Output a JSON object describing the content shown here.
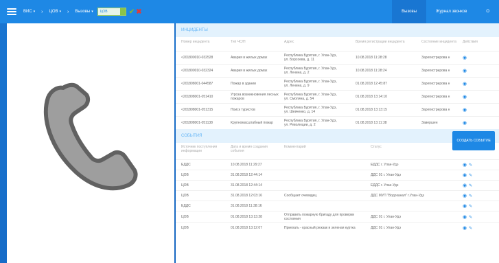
{
  "topbar": {
    "crumbs": [
      "ВИС",
      "ЦОВ",
      "Вызовы"
    ],
    "select_value": "ЦОВ",
    "ok_glyph": "✔",
    "cancel_glyph": "✖",
    "tabs": [
      "Вызовы",
      "Журнал звонков",
      "О"
    ]
  },
  "incidents": {
    "title": "ИНЦИДЕНТЫ",
    "columns": [
      "Номер инцидента",
      "Тип ЧС/П",
      "Адрес",
      "Время регистрации инцидента",
      "Состояние инцидента",
      "Действия"
    ],
    "rows": [
      {
        "num": "<201800010-032528",
        "type": "Авария в жилых домах",
        "addr1": "Республика Бурятия, г. Улан-Удэ,",
        "addr2": "ул. Борсоева, д. 11",
        "time": "10.08.2018 11:28:28",
        "state": "Зарегистрирова н"
      },
      {
        "num": "<201800010-032324",
        "type": "Авария в жилых домах",
        "addr1": "Республика Бурятия, г. Улан-Удэ,",
        "addr2": "ул. Ленина, д. 2",
        "time": "10.08.2018 11:28:24",
        "state": "Зарегистрирова н"
      },
      {
        "num": "<201808001-044587",
        "type": "Пожар в здании",
        "addr1": "Республика Бурятия, г. Улан-Удэ,",
        "addr2": "ул. Ленина, д. 9",
        "time": "01.08.2018 12:45:87",
        "state": "Зарегистрирова н"
      },
      {
        "num": "<201808001-051410",
        "type": "Угроза возникновения лесных пожаров",
        "addr1": "Республика Бурятия, г. Улан-Удэ,",
        "addr2": "ул. Смолина, д. 54",
        "time": "01.08.2018 13:14:10",
        "state": "Зарегистрирова н"
      },
      {
        "num": "<201808001-051315",
        "type": "Поиск туристов",
        "addr1": "Республика Бурятия, г. Улан-Удэ,",
        "addr2": "ул. Шевченко, д. 14",
        "time": "01.08.2018 13:13:15",
        "state": "Зарегистрирова н"
      },
      {
        "num": "<201808001-051138",
        "type": "Крупномасштабный пожар",
        "addr1": "Республика Бурятия, г. Улан-Удэ,",
        "addr2": "ул. Революции, д. 2",
        "time": "01.08.2018 13:11:38",
        "state": "Завершен"
      }
    ]
  },
  "events": {
    "title": "СОБЫТИЯ",
    "create_label": "СОЗДАТЬ СОБЫТИЕ",
    "columns": [
      "Источник поступления информации",
      "Дата и время создания события",
      "Комментарий",
      "Статус",
      "Действия"
    ],
    "rows": [
      {
        "src": "ЕДДС",
        "time": "10.08.2018 11:29:27",
        "comment": "",
        "status": "ЕДДС г. Улан-Удэ"
      },
      {
        "src": "ЦОВ",
        "time": "31.08.2018 12:44:14",
        "comment": "",
        "status": "ДДС 01 г. Улан-Удэ"
      },
      {
        "src": "ЦОВ",
        "time": "31.08.2018 12:44:14",
        "comment": "",
        "status": "ЕДДС г. Улан-Удэ"
      },
      {
        "src": "ЦОВ",
        "time": "31.08.2018 12:03:16",
        "comment": "Сообщает очевидец",
        "status": "ДДС МУП \"Водоканал\" г.Улан-Удэ"
      },
      {
        "src": "ЕДДС",
        "time": "31.08.2018 11:38:16",
        "comment": "",
        "status": ""
      },
      {
        "src": "ЦОВ",
        "time": "01.08.2018 13:13:28",
        "comment": "Отправить пожарную бригаду для проверки состояния",
        "status": "ДДС 01 г. Улан-Удэ"
      },
      {
        "src": "ЦОВ",
        "time": "01.08.2018 13:12:07",
        "comment": "Приехать - красный рюкзак и зеленая куртка",
        "status": "ДДС 01 г. Улан-Удэ"
      }
    ]
  },
  "icons": {
    "menu": "menu-icon",
    "phone": "phone-handset-icon",
    "eye": "eye-icon",
    "pencil": "pencil-icon"
  }
}
